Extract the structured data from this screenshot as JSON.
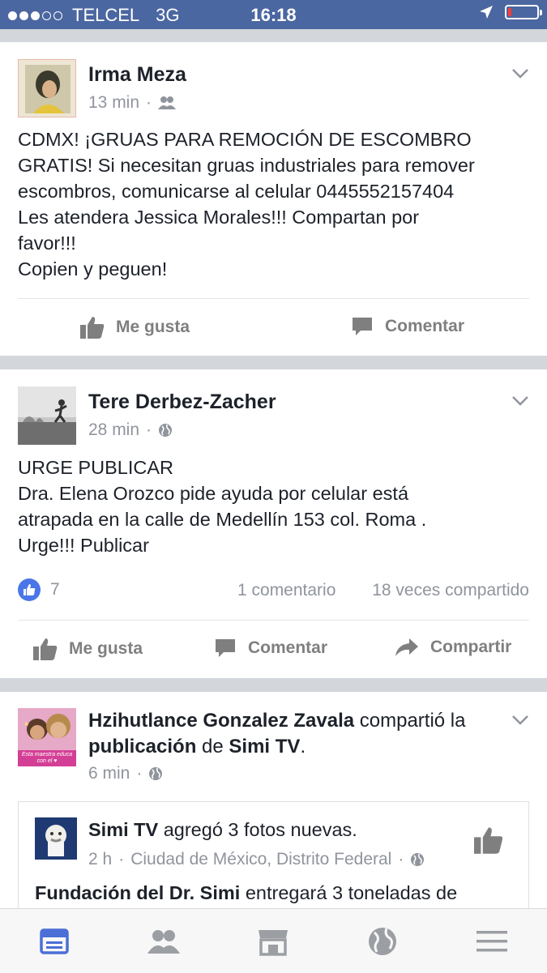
{
  "status_bar": {
    "carrier": "TELCEL",
    "network": "3G",
    "time": "16:18",
    "signal_bars": 3,
    "signal_max": 5,
    "battery_level": 0.12,
    "battery_color": "#ff3b30"
  },
  "colors": {
    "brand_blue": "#4b67a1",
    "link_blue": "#365899",
    "text": "#1d2129",
    "meta": "#90949c",
    "like_blue": "#4a76e8"
  },
  "posts": [
    {
      "author": "Irma Meza",
      "time": "13 min",
      "privacy_icon": "friends-icon",
      "body": [
        "CDMX! ¡GRUAS PARA REMOCIÓN DE ESCOMBRO",
        "GRATIS! Si necesitan gruas industriales para remover",
        "escombros, comunicarse al celular 0445552157404",
        "Les atendera Jessica Morales!!! Compartan por",
        "favor!!!",
        "Copien y peguen!"
      ],
      "actions": [
        "Me gusta",
        "Comentar"
      ]
    },
    {
      "author": "Tere Derbez-Zacher",
      "time": "28 min",
      "privacy_icon": "globe-icon",
      "body": [
        "URGE PUBLICAR",
        "Dra. Elena Orozco pide ayuda por celular está",
        "atrapada en la calle de Medellín 153 col. Roma .",
        "Urge!!! Publicar"
      ],
      "likes": "7",
      "comments": "1 comentario",
      "shares": "18 veces compartido",
      "actions": [
        "Me gusta",
        "Comentar",
        "Compartir"
      ]
    },
    {
      "author": "Hzihutlance Gonzalez Zavala",
      "verb1": "compartió la",
      "object": "publicación",
      "verb2": "de",
      "page": "Simi TV",
      "period": ".",
      "time": "6 min",
      "privacy_icon": "globe-icon",
      "avatar_caption": "Esta maestra educa con el ♥",
      "shared": {
        "author": "Simi TV",
        "verb": "agregó 3 fotos nuevas.",
        "time": "2 h",
        "location": "Ciudad de México, Distrito Federal",
        "body_bold": "Fundación del Dr. Simi",
        "body_rest": "entregará 3 toneladas de"
      }
    }
  ],
  "tab_bar": [
    "news-feed-icon",
    "friends-icon",
    "marketplace-icon",
    "notifications-globe-icon",
    "menu-icon"
  ]
}
